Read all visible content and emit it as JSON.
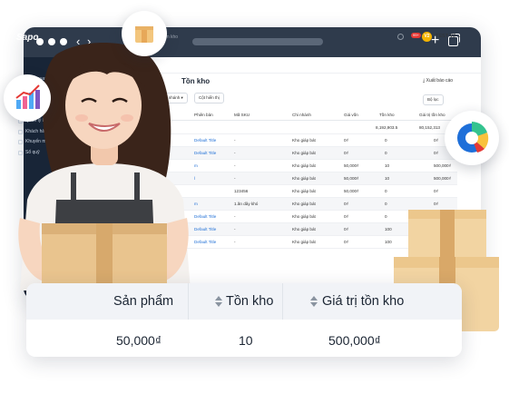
{
  "app": {
    "brand": "Sapo",
    "breadcrumb": "Tồn kho",
    "page_title": "Tồn kho",
    "shop": {
      "badge": "99+",
      "avatar_text": "V2",
      "name": "TEST V2 ⌄"
    },
    "export_label": "Xuất báo cáo",
    "sidebar_items": [
      "Tổng quan",
      "Đơn hàng",
      "Vận chuyển",
      "Sản phẩm",
      "Quản lý kho",
      "Khách hàng",
      "Khuyến mại",
      "Sổ quỹ"
    ],
    "filters": {
      "branch": "1 chi nhánh ▾",
      "columns": "Cột hiển thị",
      "filter": "Bộ lọc"
    }
  },
  "table": {
    "headers": [
      "Sản phẩm",
      "Phiên bản",
      "Mã SKU",
      "Chi nhánh",
      "Giá vốn",
      "Tồn kho",
      "Giá trị tồn kho"
    ],
    "summary": {
      "label": "Tổng sản phẩm",
      "stock": "8,192,903.5",
      "value": "80,152,313"
    },
    "rows": [
      {
        "product": "",
        "variant": "Default Title",
        "sku": "-",
        "branch": "Kho giáp bát",
        "cost": "0₫",
        "stock": "0",
        "value": "0₫"
      },
      {
        "product": "",
        "variant": "Default Title",
        "sku": "-",
        "branch": "Kho giáp bát",
        "cost": "0₫",
        "stock": "0",
        "value": "0₫"
      },
      {
        "product": "169789",
        "variant": "m",
        "sku": "-",
        "branch": "Kho giáp bát",
        "cost": "50,000₫",
        "stock": "10",
        "value": "500,000₫"
      },
      {
        "product": "",
        "variant": "l",
        "sku": "-",
        "branch": "Kho giáp bát",
        "cost": "50,000₫",
        "stock": "10",
        "value": "500,000₫"
      },
      {
        "product": "",
        "variant": "",
        "sku": "123456",
        "branch": "Kho giáp bát",
        "cost": "50,000₫",
        "stock": "0",
        "value": "0₫"
      },
      {
        "product": "",
        "variant": "m",
        "sku": "1.ăn dây khó",
        "branch": "Kho giáp bát",
        "cost": "0₫",
        "stock": "0",
        "value": "0₫"
      },
      {
        "product": "",
        "variant": "Default Title",
        "sku": "-",
        "branch": "Kho giáp bát",
        "cost": "0₫",
        "stock": "0",
        "value": "0₫"
      },
      {
        "product": "",
        "variant": "Default Title",
        "sku": "-",
        "branch": "Kho giáp bát",
        "cost": "0₫",
        "stock": "100",
        "value": "0₫"
      },
      {
        "product": "",
        "variant": "Default Title",
        "sku": "-",
        "branch": "Kho giáp bát",
        "cost": "0₫",
        "stock": "100",
        "value": "0₫"
      }
    ]
  },
  "card": {
    "headers": [
      "Sản phẩm",
      "Tồn kho",
      "Giá trị tồn kho"
    ],
    "values": [
      "50,000₫",
      "10",
      "500,000₫"
    ]
  },
  "icons": [
    "box-icon",
    "bar-chart-icon",
    "pie-chart-icon"
  ],
  "colors": {
    "titlebar": "#2f3b4c",
    "sidebar": "#182537",
    "link": "#1f6fd6",
    "accent_yellow": "#f5b400"
  }
}
